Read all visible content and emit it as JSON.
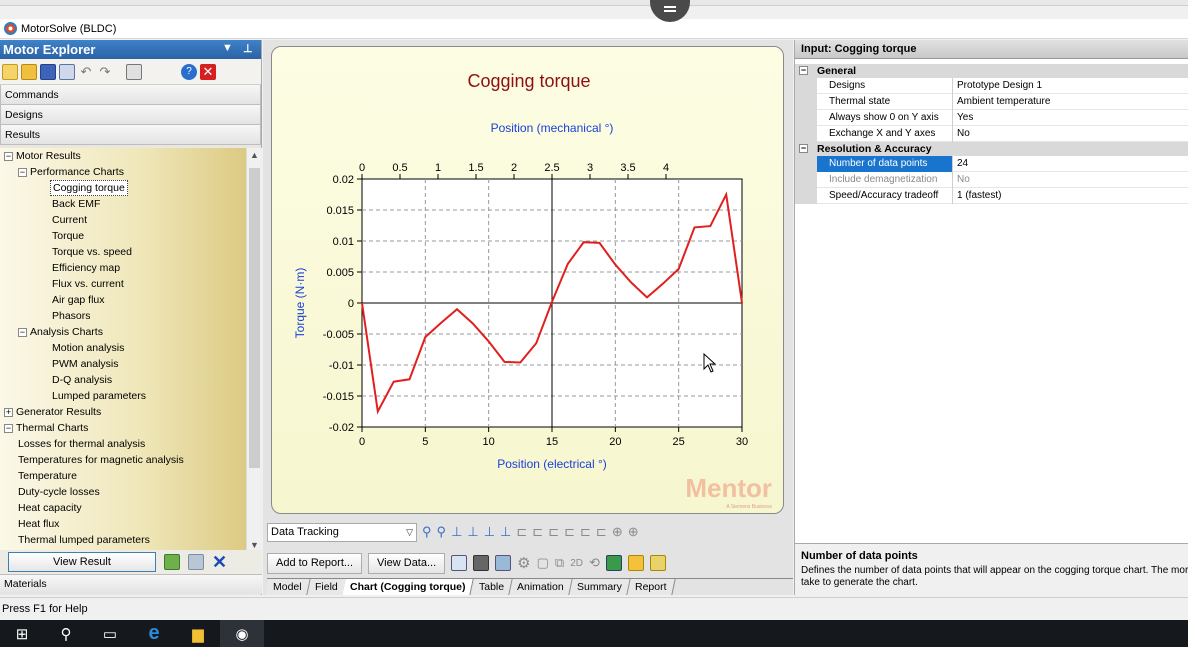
{
  "app": {
    "title": "MotorSolve (BLDC)"
  },
  "explorer": {
    "header": "Motor Explorer",
    "sections": [
      "Commands",
      "Designs",
      "Results"
    ],
    "tree": [
      {
        "label": "Motor Results",
        "level": 0,
        "box": "−"
      },
      {
        "label": "Performance Charts",
        "level": 1,
        "box": "−"
      },
      {
        "label": "Cogging torque",
        "level": 2,
        "selected": true
      },
      {
        "label": "Back EMF",
        "level": 2
      },
      {
        "label": "Current",
        "level": 2
      },
      {
        "label": "Torque",
        "level": 2
      },
      {
        "label": "Torque vs. speed",
        "level": 2
      },
      {
        "label": "Efficiency map",
        "level": 2
      },
      {
        "label": "Flux vs. current",
        "level": 2
      },
      {
        "label": "Air gap flux",
        "level": 2
      },
      {
        "label": "Phasors",
        "level": 2
      },
      {
        "label": "Analysis Charts",
        "level": 1,
        "box": "−"
      },
      {
        "label": "Motion analysis",
        "level": 2
      },
      {
        "label": "PWM analysis",
        "level": 2
      },
      {
        "label": "D-Q analysis",
        "level": 2
      },
      {
        "label": "Lumped parameters",
        "level": 2
      },
      {
        "label": "Generator Results",
        "level": 0,
        "box": "+"
      },
      {
        "label": "Thermal Charts",
        "level": 0,
        "box": "−"
      },
      {
        "label": "Losses for thermal analysis",
        "level": 1
      },
      {
        "label": "Temperatures for magnetic analysis",
        "level": 1
      },
      {
        "label": "Temperature",
        "level": 1
      },
      {
        "label": "Duty-cycle losses",
        "level": 1
      },
      {
        "label": "Heat capacity",
        "level": 1
      },
      {
        "label": "Heat flux",
        "level": 1
      },
      {
        "label": "Thermal lumped parameters",
        "level": 1
      }
    ],
    "view_result": "View Result",
    "materials": "Materials"
  },
  "chart_data": {
    "type": "line",
    "title": "Cogging torque",
    "xlabel": "Position (electrical °)",
    "x2label": "Position (mechanical °)",
    "ylabel": "Torque (N·m)",
    "xlim": [
      0,
      30
    ],
    "ylim": [
      -0.02,
      0.02
    ],
    "xticks": [
      0,
      5,
      10,
      15,
      20,
      25,
      30
    ],
    "x2ticks": [
      "0",
      "0.5",
      "1",
      "1.5",
      "2",
      "2.5",
      "3",
      "3.5",
      "4"
    ],
    "yticks": [
      "0.02",
      "0.015",
      "0.01",
      "0.005",
      "0",
      "-0.005",
      "-0.01",
      "-0.015",
      "-0.02"
    ],
    "grid": true,
    "series": [
      {
        "color": "#e0201f",
        "x": [
          0,
          1.25,
          2.5,
          3.75,
          5,
          6.25,
          7.5,
          8.75,
          10,
          11.25,
          12.5,
          13.75,
          15,
          16.25,
          17.5,
          18.75,
          20,
          21.25,
          22.5,
          23.75,
          25,
          26.25,
          27.5,
          28.75,
          30
        ],
        "y": [
          0,
          -0.0175,
          -0.0127,
          -0.0123,
          -0.0055,
          -0.0032,
          -0.001,
          -0.0033,
          -0.0062,
          -0.0095,
          -0.0096,
          -0.0065,
          0.0002,
          0.0063,
          0.0098,
          0.0097,
          0.0062,
          0.0033,
          0.0009,
          0.0031,
          0.0055,
          0.0122,
          0.0124,
          0.0175,
          0
        ]
      }
    ]
  },
  "watermark": {
    "brand": "Mentor",
    "sub": "A Siemens Business"
  },
  "center": {
    "data_tracking": "Data Tracking",
    "add_to_report": "Add to Report...",
    "view_data": "View Data...",
    "tabs": [
      "Model",
      "Field",
      "Chart (Cogging torque)",
      "Table",
      "Animation",
      "Summary",
      "Report"
    ],
    "active_tab": 2
  },
  "properties": {
    "title": "Input: Cogging torque",
    "general": {
      "label": "General",
      "rows": [
        {
          "name": "Designs",
          "value": "Prototype Design 1"
        },
        {
          "name": "Thermal state",
          "value": "Ambient temperature"
        },
        {
          "name": "Always show 0 on Y axis",
          "value": "Yes"
        },
        {
          "name": "Exchange X and Y axes",
          "value": "No"
        }
      ]
    },
    "resolution": {
      "label": "Resolution & Accuracy",
      "rows": [
        {
          "name": "Number of data points",
          "value": "24",
          "selected": true
        },
        {
          "name": "Include demagnetization",
          "value": "No",
          "disabled": true
        },
        {
          "name": "Speed/Accuracy tradeoff",
          "value": "1 (fastest)"
        }
      ]
    },
    "description": {
      "title": "Number of data points",
      "text_line1": "Defines the number of data points that will appear on the cogging torque chart. The more points you",
      "text_line2": "take to generate the chart."
    }
  },
  "statusbar": {
    "text": "Press F1 for Help"
  }
}
